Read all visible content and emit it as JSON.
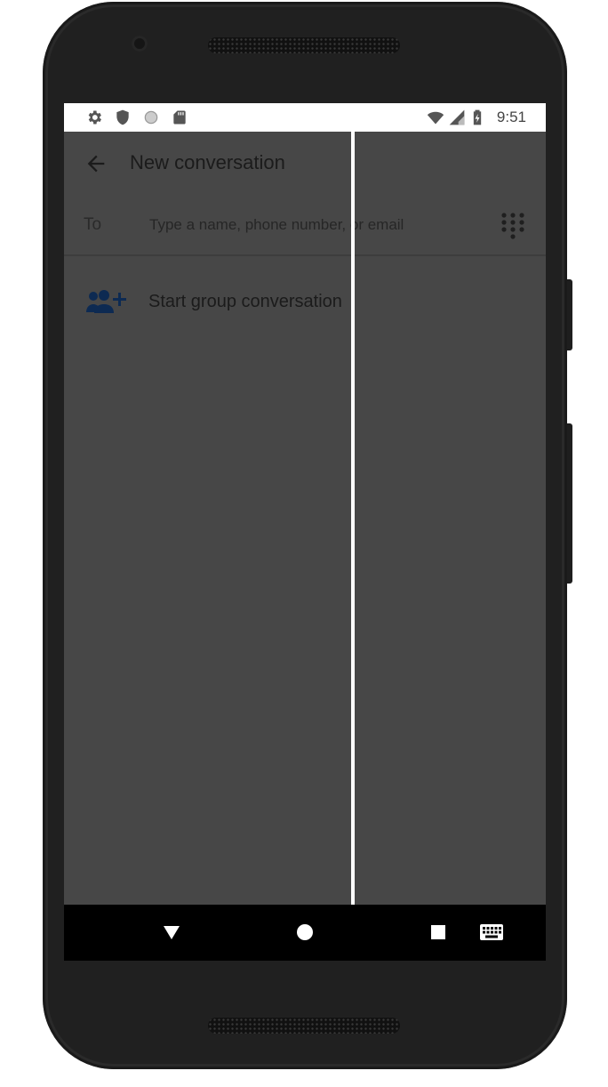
{
  "status_bar": {
    "time": "9:51",
    "left_icons": [
      "settings-icon",
      "shield-icon",
      "circle-icon",
      "sd-card-icon"
    ],
    "right_icons": [
      "wifi-icon",
      "signal-icon",
      "battery-charging-icon"
    ]
  },
  "app_bar": {
    "title": "New conversation",
    "back_icon": "arrow-back-icon"
  },
  "recipient": {
    "label": "To",
    "placeholder": "Type a name, phone number, or email",
    "value": "",
    "dialpad_icon": "dialpad-icon"
  },
  "actions": {
    "start_group_label": "Start group conversation",
    "start_group_icon": "group-add-icon"
  },
  "nav_bar": {
    "buttons": [
      "back-triangle-icon",
      "home-circle-icon",
      "recents-square-icon",
      "keyboard-icon"
    ]
  },
  "colors": {
    "scrim": "#474747",
    "group_icon": "#0d2a52",
    "status_bar_bg": "#ffffff",
    "nav_bar_bg": "#000000"
  }
}
